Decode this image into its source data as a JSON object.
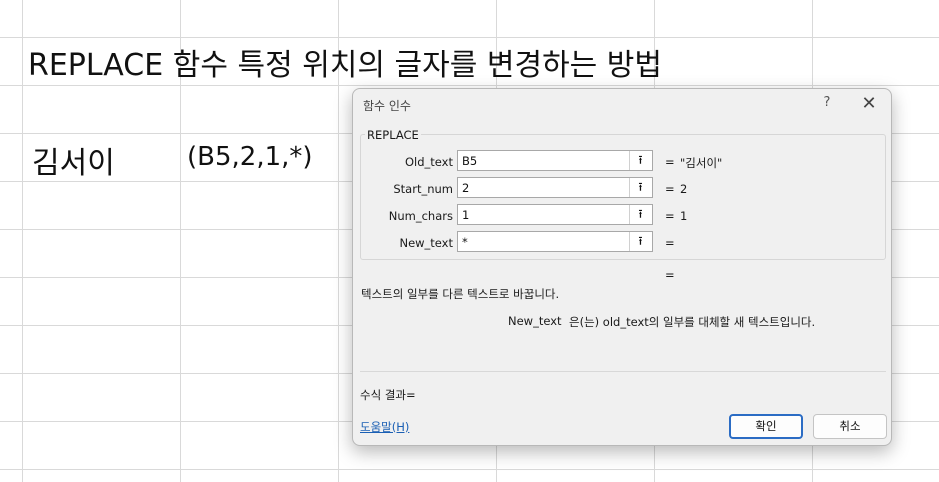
{
  "sheet": {
    "title": "REPLACE 함수 특정 위치의 글자를 변경하는 방법",
    "cell_name": "김서이",
    "cell_formula": "(B5,2,1,*)"
  },
  "dialog": {
    "title": "함수 인수",
    "help_glyph": "?",
    "close_glyph": "✕",
    "function_name": "REPLACE",
    "collapse_glyph": "⭱",
    "equals": "=",
    "args": [
      {
        "label": "Old_text",
        "value": "B5",
        "result": "\"김서이\""
      },
      {
        "label": "Start_num",
        "value": "2",
        "result": "2"
      },
      {
        "label": "Num_chars",
        "value": "1",
        "result": "1"
      },
      {
        "label": "New_text",
        "value": "*",
        "result": ""
      }
    ],
    "function_result": "",
    "description": "텍스트의 일부를 다른 텍스트로 바꿉니다.",
    "arg_desc_label": "New_text",
    "arg_desc": "은(는) old_text의 일부를 대체할 새 텍스트입니다.",
    "formula_result_label": "수식 결과=",
    "help_link": "도움말(H)",
    "ok_label": "확인",
    "cancel_label": "취소"
  }
}
